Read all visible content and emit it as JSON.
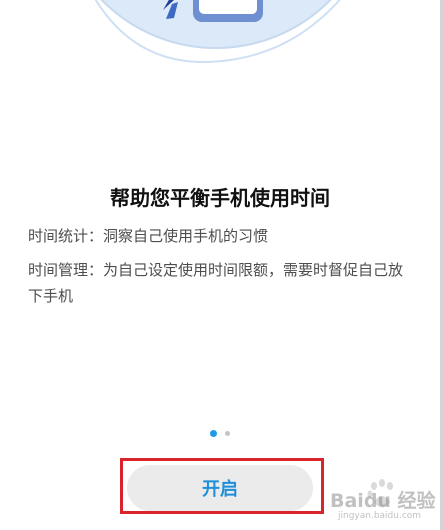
{
  "onboarding": {
    "title": "帮助您平衡手机使用时间",
    "descriptions": [
      "时间统计：洞察自己使用手机的习惯",
      "时间管理：为自己设定使用时间限额，需要时督促自己放下手机"
    ],
    "pager": {
      "total_pages": 2,
      "current_page": 1
    },
    "start_button_label": "开启"
  },
  "watermark": {
    "brand_text": "Baidu 经验",
    "sub_text": "jingyan.baidu.com"
  },
  "colors": {
    "accent": "#1e9be6",
    "highlight_box": "#d9242b",
    "hero_circle": "#dce9f8",
    "button_bg": "#ebebeb"
  }
}
